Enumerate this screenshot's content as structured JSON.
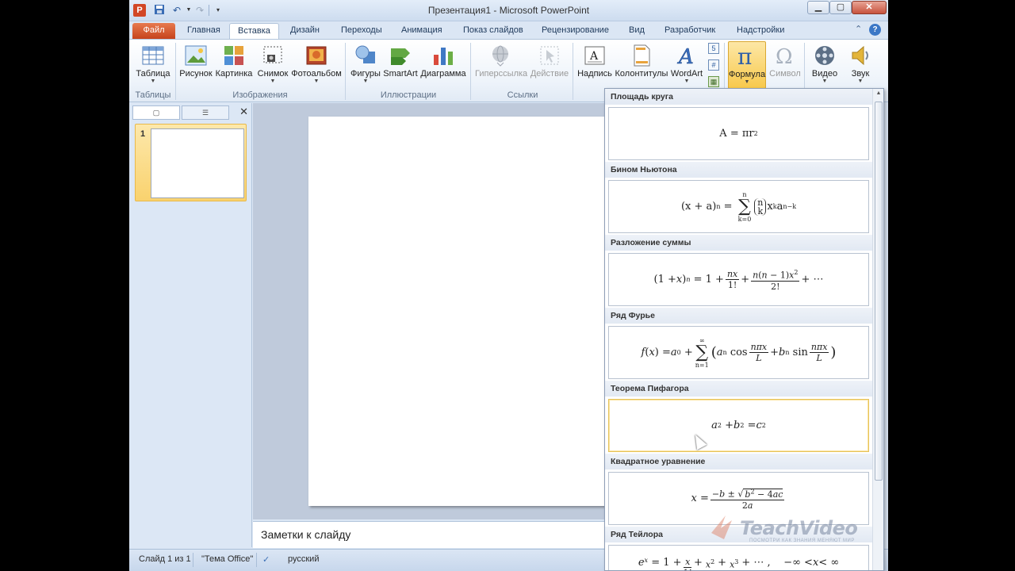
{
  "window": {
    "title": "Презентация1 - Microsoft PowerPoint",
    "app_icon_letter": "P"
  },
  "tabs": {
    "file": "Файл",
    "items": [
      "Главная",
      "Вставка",
      "Дизайн",
      "Переходы",
      "Анимация",
      "Показ слайдов",
      "Рецензирование",
      "Вид",
      "Разработчик",
      "Надстройки"
    ],
    "active": "Вставка"
  },
  "ribbon": {
    "buttons": {
      "table": "Таблица",
      "picture": "Рисунок",
      "clipart": "Картинка",
      "screenshot": "Снимок",
      "photoalbum": "Фотоальбом",
      "shapes": "Фигуры",
      "smartart": "SmartArt",
      "chart": "Диаграмма",
      "hyperlink": "Гиперссылка",
      "action": "Действие",
      "textbox": "Надпись",
      "headerfooter": "Колонтитулы",
      "wordart": "WordArt",
      "equation": "Формула",
      "symbol": "Символ",
      "video": "Видео",
      "audio": "Звук"
    },
    "groups": {
      "tables": "Таблицы",
      "images": "Изображения",
      "illustrations": "Иллюстрации",
      "links": "Ссылки"
    }
  },
  "slides_panel": {
    "slide_number": "1"
  },
  "notes": {
    "placeholder": "Заметки к слайду"
  },
  "status": {
    "slide": "Слайд 1 из 1",
    "theme": "\"Тема Office\"",
    "language": "русский"
  },
  "gallery": {
    "items": [
      {
        "title": "Площадь круга"
      },
      {
        "title": "Бином Ньютона"
      },
      {
        "title": "Разложение суммы"
      },
      {
        "title": "Ряд Фурье"
      },
      {
        "title": "Теорема Пифагора"
      },
      {
        "title": "Квадратное уравнение"
      },
      {
        "title": "Ряд Тейлора"
      }
    ]
  },
  "watermark": {
    "brand": "TeachVideo",
    "tagline": "ПОСМОТРИ КАК ЗНАНИЯ МЕНЯЮТ МИР"
  }
}
